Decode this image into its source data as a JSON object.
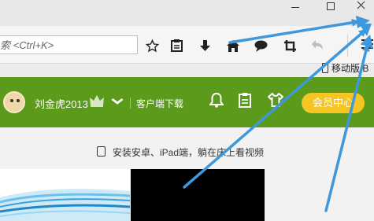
{
  "toolbar": {
    "url_placeholder": "索 <Ctrl+K>",
    "icons": [
      "star-icon",
      "reading-list-icon",
      "download-icon",
      "home-icon",
      "chat-icon",
      "crop-icon",
      "back-icon",
      "hamburger-menu-icon"
    ]
  },
  "bookmarks": {
    "mobile_label": "移动版 B",
    "icon": "phone-icon"
  },
  "site_header": {
    "username": "刘金虎2013",
    "client_download": "客户端下载",
    "vip_center": "会员中心",
    "colors": {
      "header_bg": "#5c9a1c",
      "vip_button": "#f4c523"
    }
  },
  "content": {
    "install_text": "安装安卓、iPad端，躺在床上看视频"
  },
  "annotations": {
    "arrow_color": "#3f97dc"
  }
}
